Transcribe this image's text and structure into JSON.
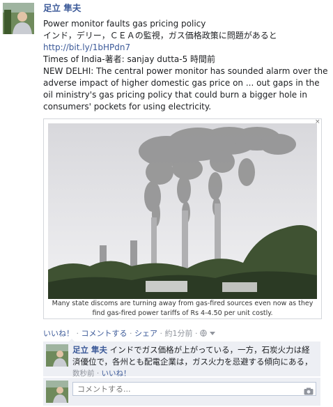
{
  "post": {
    "author": "足立 隼夫",
    "headline": "Power monitor faults gas pricing policy",
    "summary_ja": "インド，デリー，ＣＥＡの監視，ガス価格政策に問題があると",
    "link": "http://bit.ly/1bHPdn7",
    "source": "Times of India-著者: sanjay dutta-5 時間前",
    "body": "NEW DELHI: The central power monitor has sounded alarm over the adverse impact of higher domestic gas price on ... out gaps in the oil ministry's gas pricing policy that could burn a bigger hole in consumers' pockets for using electricity.",
    "close": "×"
  },
  "preview": {
    "caption": "Many state discoms are turning away from gas-fired sources even now as they find gas-fired power tariffs of Rs 4-4.50 per unit costly."
  },
  "actions": {
    "like": "いいね！",
    "comment": "コメントする",
    "share": "シェア",
    "time": "約1分前",
    "separator": "·",
    "audience_icon": "globe-icon"
  },
  "comment": {
    "author": "足立 隼夫",
    "text": "インドでガス価格が上がっている，一方，石炭火力は経済優位で，各州とも配電企業は，ガス火力を忌避する傾向にある，",
    "time": "数秒前",
    "like": "いいね！"
  },
  "reply": {
    "placeholder": "コメントする...",
    "camera_icon": "camera-icon"
  }
}
